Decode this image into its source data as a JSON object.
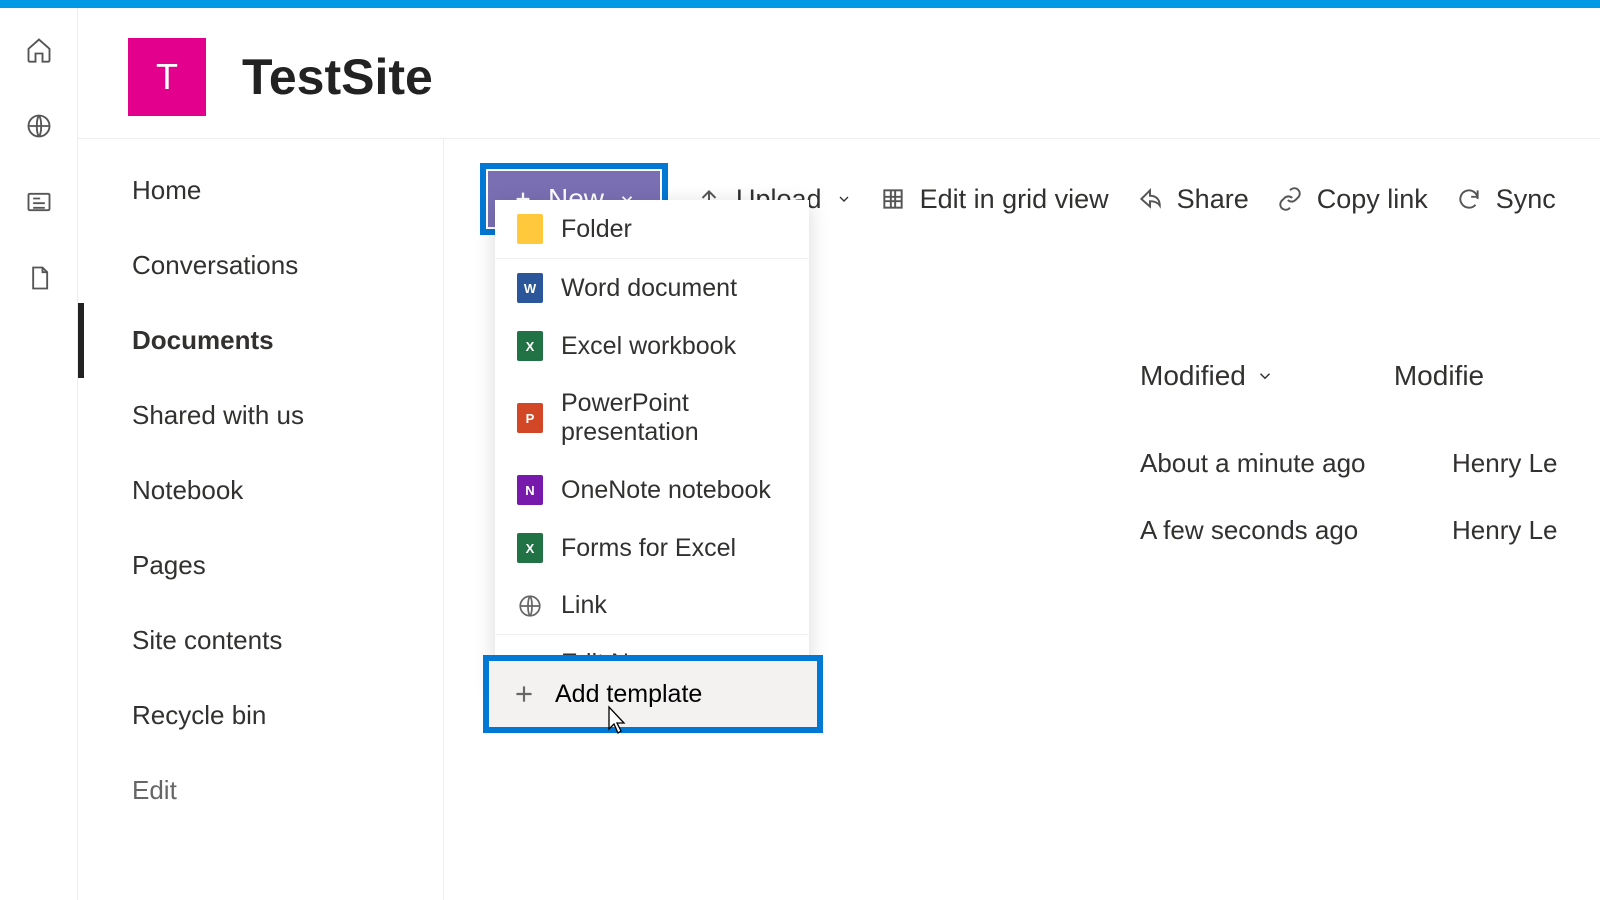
{
  "site": {
    "logo_letter": "T",
    "title": "TestSite"
  },
  "sidebar": {
    "items": [
      {
        "label": "Home"
      },
      {
        "label": "Conversations"
      },
      {
        "label": "Documents",
        "active": true
      },
      {
        "label": "Shared with us"
      },
      {
        "label": "Notebook"
      },
      {
        "label": "Pages"
      },
      {
        "label": "Site contents"
      },
      {
        "label": "Recycle bin"
      }
    ],
    "edit_label": "Edit"
  },
  "toolbar": {
    "new_label": "New",
    "upload_label": "Upload",
    "edit_grid_label": "Edit in grid view",
    "share_label": "Share",
    "copy_link_label": "Copy link",
    "sync_label": "Sync"
  },
  "new_menu": {
    "folder": "Folder",
    "word": "Word document",
    "excel": "Excel workbook",
    "ppt": "PowerPoint presentation",
    "onenote": "OneNote notebook",
    "forms": "Forms for Excel",
    "link": "Link",
    "edit_menu": "Edit New menu",
    "add_template": "Add template"
  },
  "table": {
    "headers": {
      "modified": "Modified",
      "modified_by": "Modifie"
    },
    "rows": [
      {
        "modified": "About a minute ago",
        "modified_by": "Henry Le"
      },
      {
        "modified": "A few seconds ago",
        "modified_by": "Henry Le"
      }
    ]
  }
}
